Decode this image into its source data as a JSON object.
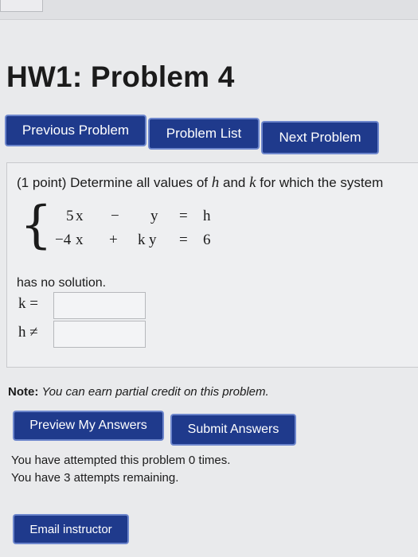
{
  "page": {
    "title": "HW1: Problem 4"
  },
  "nav": {
    "previous": "Previous Problem",
    "list": "Problem List",
    "next": "Next Problem"
  },
  "problem": {
    "points": "(1 point)",
    "prompt_start": "Determine all values of",
    "var_h": "h",
    "and": "and",
    "var_k": "k",
    "prompt_end": "for which the system",
    "eq1": {
      "a": "5",
      "x": "x",
      "op": "−",
      "b": "",
      "y": "y",
      "eq": "=",
      "rhs": "h"
    },
    "eq2": {
      "a": "−4",
      "x": "x",
      "op": "+",
      "b": "k",
      "y": "y",
      "eq": "=",
      "rhs": "6"
    },
    "no_solution": "has no solution.",
    "k_label": "k =",
    "h_label": "h ≠",
    "k_value": "",
    "h_value": ""
  },
  "note": {
    "label": "Note:",
    "text": "You can earn partial credit on this problem."
  },
  "actions": {
    "preview": "Preview My Answers",
    "submit": "Submit Answers"
  },
  "status": {
    "line1": "You have attempted this problem 0 times.",
    "line2": "You have 3 attempts remaining."
  },
  "footer": {
    "email": "Email instructor"
  }
}
